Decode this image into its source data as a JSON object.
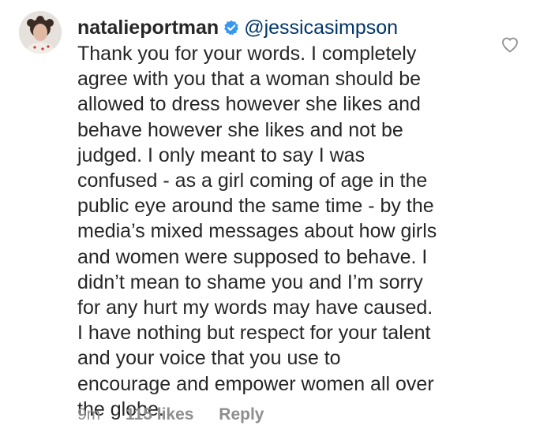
{
  "comment": {
    "username": "natalieportman",
    "mention": "@jessicasimpson",
    "lines": [
      "Thank you for your words. I completely",
      "agree with you that a woman should be",
      "allowed to dress however she likes and",
      "behave however she likes and not be",
      "judged. I only meant to say I was",
      "confused - as a girl coming of age in the",
      "public eye around the same time - by the",
      "media’s mixed messages about how girls",
      "and women were supposed to behave. I",
      "didn’t mean to shame you and I’m sorry",
      "for any hurt my words may have caused.",
      "I have nothing but respect for your talent",
      "and your voice that you use to",
      "encourage and empower women all over",
      "the globe."
    ],
    "time": "9m",
    "likes": "115 likes",
    "reply": "Reply"
  },
  "icons": {
    "verified": "verified-badge-icon",
    "like": "heart-outline-icon"
  },
  "colors": {
    "verified_blue": "#3897f0",
    "mention": "#003569",
    "meta_gray": "#8e8e8e",
    "text": "#262626"
  }
}
